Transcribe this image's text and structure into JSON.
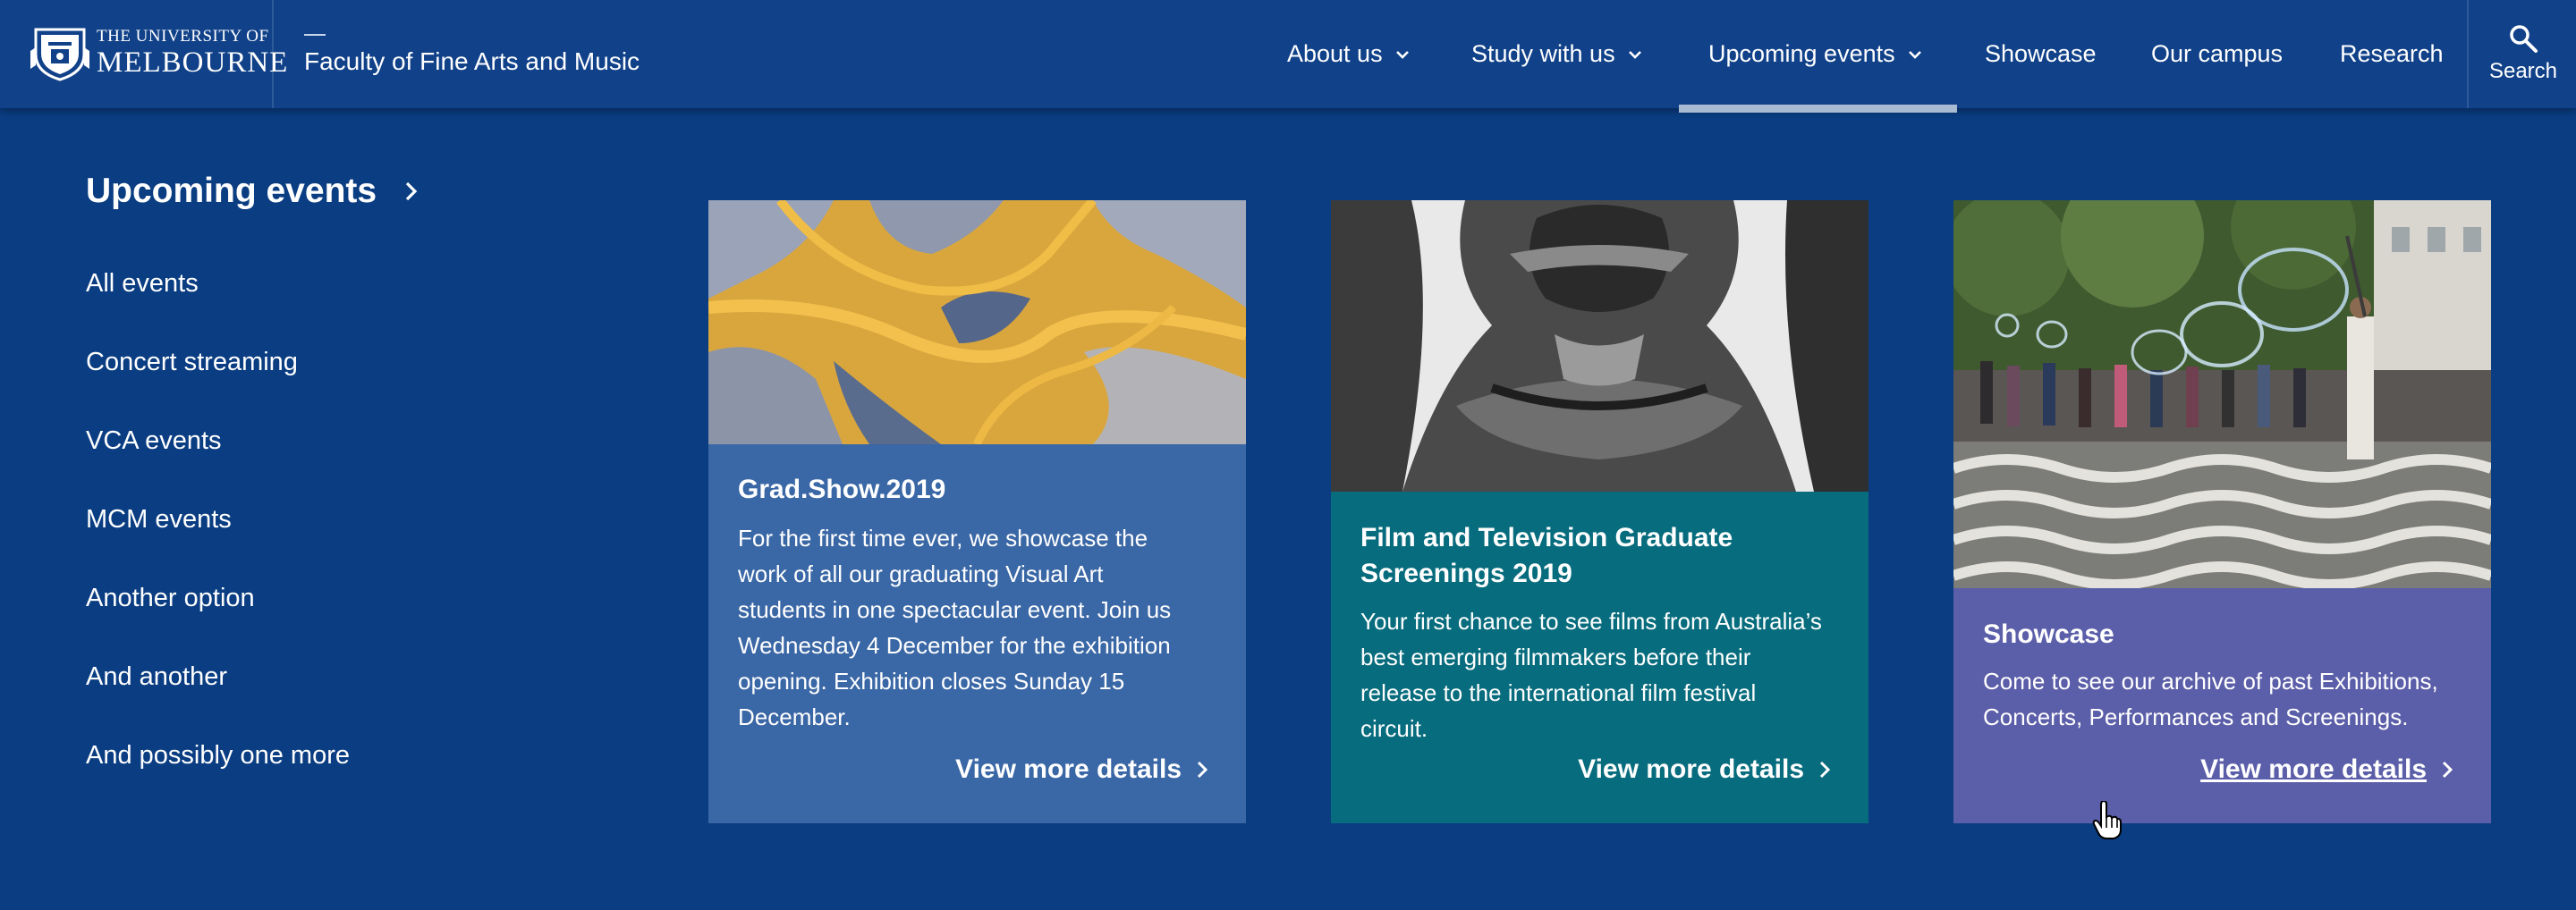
{
  "header": {
    "logo_line1": "THE UNIVERSITY OF",
    "logo_line2": "MELBOURNE",
    "faculty": "Faculty of Fine Arts and Music",
    "nav": [
      {
        "label": "About us",
        "has_dropdown": true
      },
      {
        "label": "Study with us",
        "has_dropdown": true
      },
      {
        "label": "Upcoming events",
        "has_dropdown": true,
        "active": true
      },
      {
        "label": "Showcase",
        "has_dropdown": false
      },
      {
        "label": "Our campus",
        "has_dropdown": false
      },
      {
        "label": "Research",
        "has_dropdown": false
      }
    ],
    "search_label": "Search",
    "search_icon": "search-icon"
  },
  "menu": {
    "title": "Upcoming events",
    "links": [
      "All events",
      "Concert streaming",
      "VCA events",
      "MCM events",
      "Another option",
      "And another",
      "And possibly one more"
    ]
  },
  "cards": [
    {
      "title_lines": [
        "Grad.Show.2019"
      ],
      "desc_lines": [
        "For the first time ever, we showcase the",
        "work of all our graduating Visual Art",
        "students in one spectacular event. Join us",
        "Wednesday 4 December for the exhibition",
        "opening. Exhibition closes Sunday 15",
        "December."
      ],
      "link": "View more details",
      "color": "#3a67a5",
      "image": "aerial-landscape-photo"
    },
    {
      "title_lines": [
        "Film and Television Graduate",
        "Screenings 2019"
      ],
      "desc_lines": [
        "Your first chance to see films from Australia’s",
        "best emerging filmmakers before their",
        "release to the international film festival",
        "circuit."
      ],
      "link": "View more details",
      "color": "#076c7d",
      "image": "sculpture-photo"
    },
    {
      "title_lines": [
        "Showcase"
      ],
      "desc_lines": [
        "Come to see our archive of past Exhibitions,",
        "Concerts, Performances and Screenings."
      ],
      "link": "View more details",
      "color": "#5b5ea8",
      "image": "bubbles-plaza-photo",
      "link_underlined": true
    }
  ],
  "colors": {
    "background": "#0a3d82",
    "header": "#104189",
    "active_indicator": "#a9bad3"
  }
}
